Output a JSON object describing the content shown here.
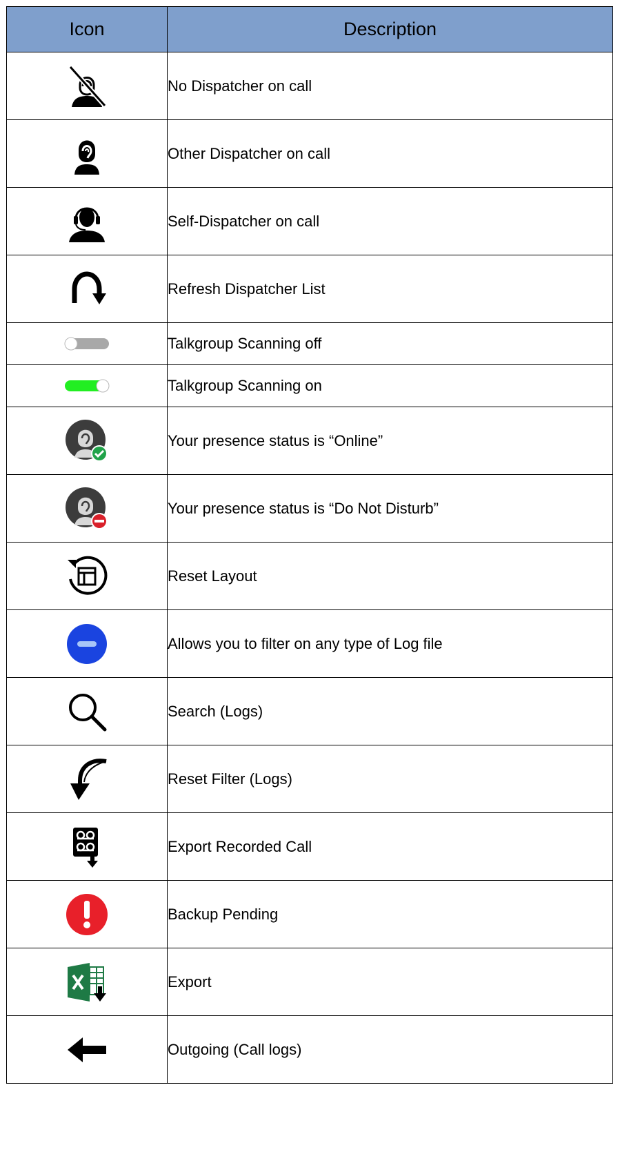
{
  "table": {
    "headers": {
      "icon": "Icon",
      "description": "Description"
    },
    "colors": {
      "header_bg": "#7f9fcc",
      "border": "#000000",
      "toggle_on": "#22ee22",
      "minus_blue": "#1a44e0",
      "alert_red": "#e8202a",
      "excel_green": "#1e7a45",
      "status_ok": "#21a34a",
      "status_dnd": "#d9202a"
    },
    "rows": [
      {
        "icon": "no-dispatcher-icon",
        "description": "No Dispatcher on call"
      },
      {
        "icon": "other-dispatcher-icon",
        "description": "Other Dispatcher on call"
      },
      {
        "icon": "self-dispatcher-icon",
        "description": "Self-Dispatcher on call"
      },
      {
        "icon": "refresh-icon",
        "description": "Refresh Dispatcher List"
      },
      {
        "icon": "toggle-off-icon",
        "description": "Talkgroup Scanning off"
      },
      {
        "icon": "toggle-on-icon",
        "description": "Talkgroup Scanning on"
      },
      {
        "icon": "presence-online-icon",
        "description": "Your presence status is “Online”"
      },
      {
        "icon": "presence-dnd-icon",
        "description": "Your presence status is “Do Not Disturb”"
      },
      {
        "icon": "reset-layout-icon",
        "description": "Reset Layout"
      },
      {
        "icon": "filter-minus-icon",
        "description": "Allows you to filter on any type of Log file"
      },
      {
        "icon": "search-icon",
        "description": "Search (Logs)"
      },
      {
        "icon": "reset-filter-icon",
        "description": "Reset Filter (Logs)"
      },
      {
        "icon": "export-recorded-call-icon",
        "description": "Export Recorded Call"
      },
      {
        "icon": "backup-pending-icon",
        "description": "Backup Pending"
      },
      {
        "icon": "excel-export-icon",
        "description": "Export"
      },
      {
        "icon": "outgoing-arrow-icon",
        "description": "Outgoing (Call logs)"
      }
    ]
  }
}
